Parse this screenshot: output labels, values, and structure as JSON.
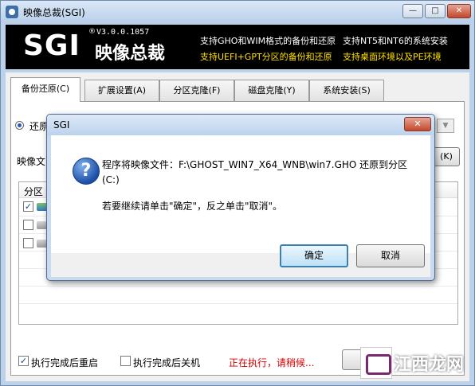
{
  "window": {
    "title": "映像总裁(SGI)",
    "minimize_label": "—",
    "maximize_label": "□",
    "close_label": "✕"
  },
  "banner": {
    "logo": "SGI",
    "registered": "®",
    "version": "V3.0.0.1057",
    "brand": "映像总裁",
    "features_white": [
      "支持GHO和WIM格式的备份和还原",
      "支持NT5和NT6的系统安装"
    ],
    "features_yellow": [
      "支持UEFI+GPT分区的备份和还原",
      "支持桌面环境以及PE环境"
    ]
  },
  "tabs": [
    {
      "label": "备份还原(C)"
    },
    {
      "label": "扩展设置(A)"
    },
    {
      "label": "分区克隆(F)"
    },
    {
      "label": "磁盘克隆(Y)"
    },
    {
      "label": "系统安装(S)"
    }
  ],
  "main": {
    "restore_label": "还原",
    "image_file_label": "映像文",
    "browse_label": "(K)",
    "partition_header": "分区",
    "rows": [
      {
        "checked": true
      },
      {
        "checked": false
      },
      {
        "checked": false
      }
    ],
    "reboot_label": "执行完成后重启",
    "reboot_checked": true,
    "shutdown_label": "执行完成后关机",
    "shutdown_checked": false,
    "status_text": "正在执行，请稍候...",
    "status_color": "#d40000"
  },
  "dialog": {
    "title": "SGI",
    "close_label": "✕",
    "icon": "question-icon",
    "message": "程序将映像文件：F:\\GHOST_WIN7_X64_WNB\\win7.GHO 还原到分区(C:)",
    "prompt": "若要继续请单击\"确定\"，反之单击\"取消\"。",
    "ok_label": "确定",
    "cancel_label": "取消"
  },
  "watermark": {
    "text": "江西龙网"
  }
}
